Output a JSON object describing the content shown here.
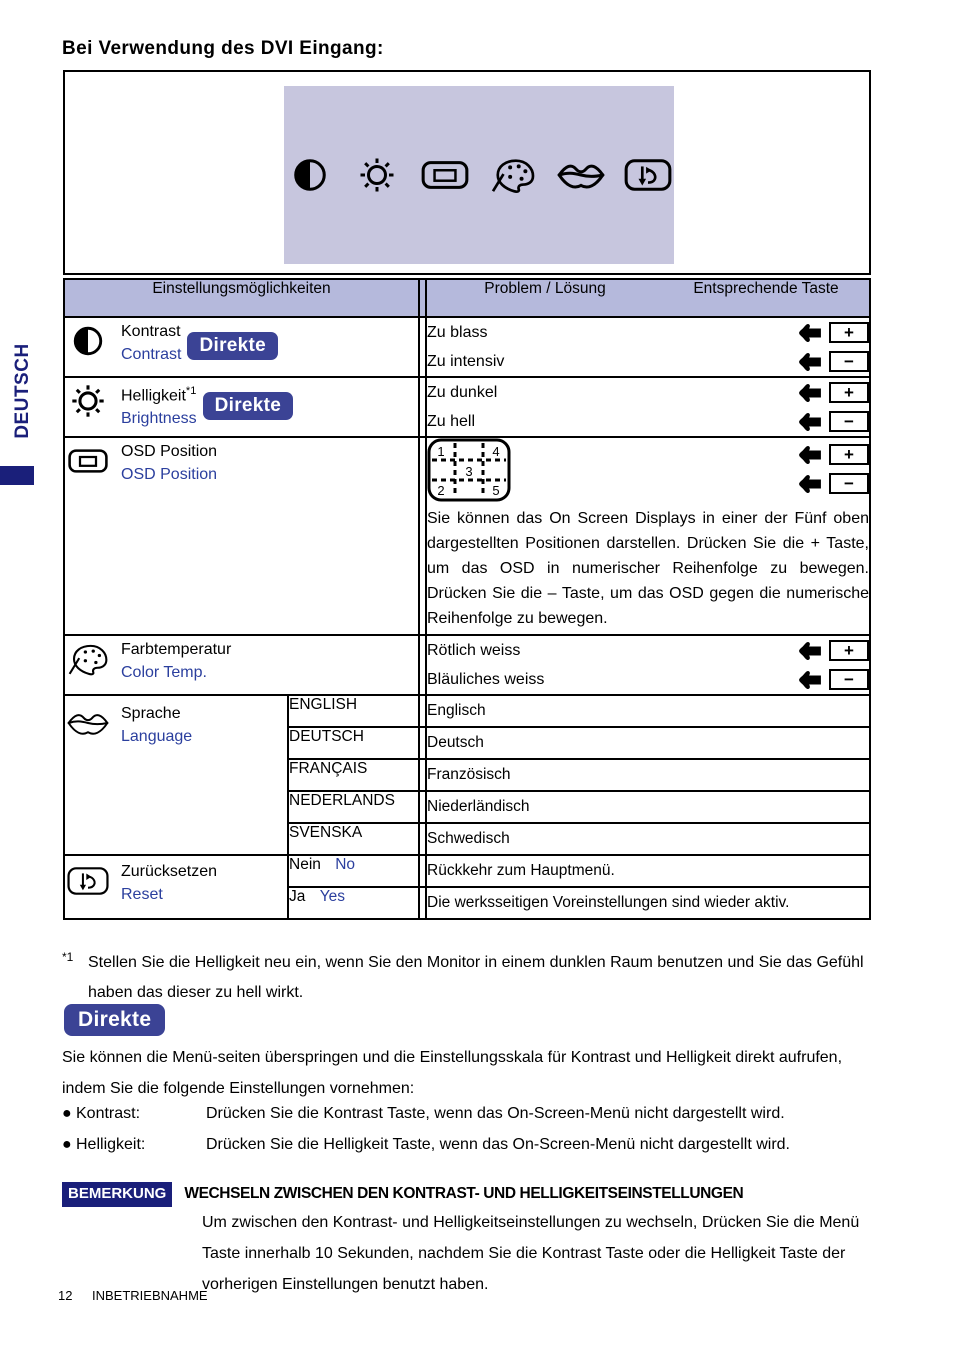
{
  "side_tab": {
    "language_label": "DEUTSCH"
  },
  "page_title": "Bei Verwendung des DVI Eingang:",
  "osd_preview": {
    "icons": [
      {
        "name": "contrast-icon",
        "label": "Contrast"
      },
      {
        "name": "brightness-icon",
        "label": "Brightness"
      },
      {
        "name": "osd-position-icon",
        "label": "OSD Position"
      },
      {
        "name": "color-temp-icon",
        "label": "Color Temp."
      },
      {
        "name": "language-icon",
        "label": "Language"
      },
      {
        "name": "reset-icon",
        "label": "Reset"
      }
    ]
  },
  "table": {
    "header": {
      "col_settings": "Einstellungsmöglichkeiten",
      "col_problem": "Problem / Lösung",
      "col_button": "Entsprechende Taste"
    },
    "rows": {
      "contrast": {
        "name_de": "Kontrast",
        "name_en": "Contrast",
        "badge": "Direkte",
        "problems": [
          {
            "text": "Zu blass",
            "key": "+"
          },
          {
            "text": "Zu intensiv",
            "key": "−"
          }
        ]
      },
      "brightness": {
        "name_de": "Helligkeit",
        "footnote_mark": "*1",
        "name_en": "Brightness",
        "badge": "Direkte",
        "problems": [
          {
            "text": "Zu dunkel",
            "key": "+"
          },
          {
            "text": "Zu hell",
            "key": "−"
          }
        ]
      },
      "osd_position": {
        "name_de": "OSD Position",
        "name_en": "OSD Position",
        "position_map": {
          "top_left": "1",
          "top_right": "4",
          "center": "3",
          "bottom_left": "2",
          "bottom_right": "5"
        },
        "keys": [
          "+",
          "−"
        ],
        "description": "Sie können das On Screen Displays in einer der Fünf oben dargestellten Positionen darstellen. Drücken Sie die + Taste, um das OSD in numerischer Reihenfolge zu bewegen. Drücken Sie die – Taste, um das OSD gegen die numerische Reihenfolge zu bewegen."
      },
      "color_temp": {
        "name_de": "Farbtemperatur",
        "name_en": "Color Temp.",
        "problems": [
          {
            "text": "Rötlich weiss",
            "key": "+"
          },
          {
            "text": "Bläuliches weiss",
            "key": "−"
          }
        ]
      },
      "language": {
        "name_de": "Sprache",
        "name_en": "Language",
        "options": [
          {
            "value": "ENGLISH",
            "meaning": "Englisch"
          },
          {
            "value": "DEUTSCH",
            "meaning": "Deutsch"
          },
          {
            "value": "FRANÇAIS",
            "meaning": "Französisch"
          },
          {
            "value": "NEDERLANDS",
            "meaning": "Niederländisch"
          },
          {
            "value": "SVENSKA",
            "meaning": "Schwedisch"
          }
        ]
      },
      "reset": {
        "name_de": "Zurücksetzen",
        "name_en": "Reset",
        "options": [
          {
            "value_de": "Nein",
            "value_en": "No",
            "meaning": "Rückkehr zum Hauptmenü."
          },
          {
            "value_de": "Ja",
            "value_en": "Yes",
            "meaning": "Die werksseitigen Voreinstellungen sind wieder aktiv."
          }
        ]
      }
    }
  },
  "footnote": {
    "mark": "*1",
    "text": "Stellen Sie die Helligkeit neu ein, wenn Sie den Monitor in einem dunklen Raum benutzen und Sie das Gefühl haben das dieser zu hell wirkt."
  },
  "direct_section": {
    "badge": "Direkte",
    "intro": "Sie können die Menü-seiten überspringen und die Einstellungsskala für Kontrast und Helligkeit direkt aufrufen, indem Sie die folgende Einstellungen vornehmen:",
    "bullets": [
      {
        "label": "Kontrast:",
        "text": "Drücken Sie die Kontrast Taste, wenn das On-Screen-Menü nicht dargestellt wird."
      },
      {
        "label": "Helligkeit:",
        "text": "Drücken Sie die Helligkeit Taste, wenn das On-Screen-Menü nicht dargestellt wird."
      }
    ]
  },
  "remark": {
    "tag": "BEMERKUNG",
    "heading": "WECHSELN ZWISCHEN DEN KONTRAST- UND HELLIGKEITSEINSTELLUNGEN",
    "body": "Um zwischen den Kontrast- und Helligkeitseinstellungen zu wechseln, Drücken Sie die Menü Taste innerhalb 10 Sekunden, nachdem Sie die Kontrast Taste oder die Helligkeit Taste der vorherigen Einstellungen benutzt haben."
  },
  "footer": {
    "page_number": "12",
    "section": "INBETRIEBNAHME"
  },
  "colors": {
    "accent_navy": "#1a1f7a",
    "badge_navy": "#3b4395",
    "header_lavender": "#b5b9dc",
    "panel_lavender": "#c7c6de",
    "english_blue": "#2b3f9e"
  }
}
